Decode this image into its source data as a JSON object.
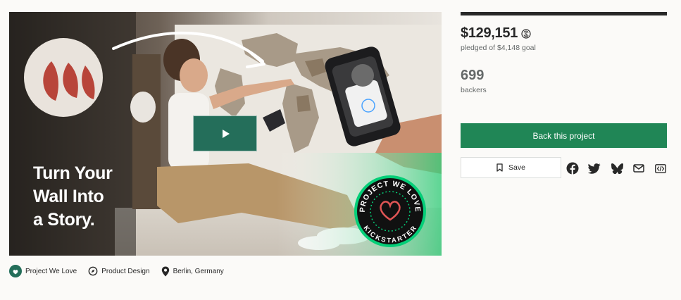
{
  "video": {
    "headline_lines": [
      "Turn Your",
      "Wall Into",
      "a Story."
    ],
    "badge_top_text": "PROJECT WE LOVE",
    "badge_bottom_text": "KICKSTARTER",
    "play_icon": "play-icon"
  },
  "tags": [
    {
      "label": "Project We Love",
      "icon": "kickstarter-logo-icon"
    },
    {
      "label": "Product Design",
      "icon": "compass-icon"
    },
    {
      "label": "Berlin, Germany",
      "icon": "location-pin-icon"
    }
  ],
  "funding": {
    "progress": 1.0,
    "amount": "$129,151",
    "currency_icon": "currency-conversion-icon",
    "pledged_text": "pledged of $4,148 goal",
    "backers_count": "699",
    "backers_label": "backers"
  },
  "actions": {
    "back_label": "Back this project",
    "save_label": "Save",
    "share_icons": [
      "facebook-icon",
      "twitter-icon",
      "bluesky-icon",
      "email-icon",
      "embed-icon"
    ]
  },
  "colors": {
    "primary_green": "#208656",
    "play_button": "#246e5a",
    "text_dark": "#282828",
    "text_muted": "#656969"
  }
}
